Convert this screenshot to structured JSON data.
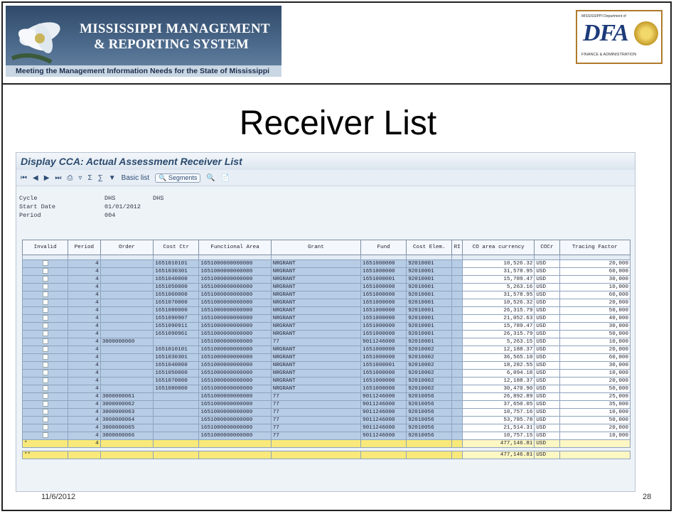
{
  "banner": {
    "line1": "MISSISSIPPI MANAGEMENT",
    "line2": "& REPORTING SYSTEM",
    "tagline": "Meeting the Management Information Needs for the State of Mississippi"
  },
  "logo": {
    "top_text": "MISSISSIPPI Department of",
    "mark": "DFA",
    "bottom_text": "FINANCE & ADMINISTRATION"
  },
  "slide_title": "Receiver List",
  "sap": {
    "window_title": "Display CCA: Actual Assessment Receiver List",
    "toolbar": {
      "basic_list": "Basic list",
      "segments": "Segments"
    },
    "meta": [
      {
        "label": "Cycle",
        "value": "DHS",
        "extra": "DHS"
      },
      {
        "label": "Start Date",
        "value": "01/01/2012",
        "extra": ""
      },
      {
        "label": "Period",
        "value": "004",
        "extra": ""
      }
    ],
    "columns": [
      "Invalid",
      "Period",
      "Order",
      "Cost Ctr",
      "Functional Area",
      "Grant",
      "Fund",
      "Cost Elem.",
      "RI",
      "CO area currency",
      "COCr",
      "Tracing Factor"
    ],
    "rows": [
      {
        "period": "4",
        "order": "",
        "cost_ctr": "1651010101",
        "func_area": "1651000000000000",
        "grant": "NRGRANT",
        "fund": "1651000000",
        "cost_elem": "92010001",
        "amount": "10,526.32",
        "cur": "USD",
        "factor": "20,000"
      },
      {
        "period": "4",
        "order": "",
        "cost_ctr": "1651030301",
        "func_area": "1651000000000000",
        "grant": "NRGRANT",
        "fund": "1651000000",
        "cost_elem": "92010001",
        "amount": "31,578.95",
        "cur": "USD",
        "factor": "60,000"
      },
      {
        "period": "4",
        "order": "",
        "cost_ctr": "1651040000",
        "func_area": "1651000000000000",
        "grant": "NRGRANT",
        "fund": "1651000001",
        "cost_elem": "92010001",
        "amount": "15,789.47",
        "cur": "USD",
        "factor": "30,000"
      },
      {
        "period": "4",
        "order": "",
        "cost_ctr": "1651050000",
        "func_area": "1651000000000000",
        "grant": "NRGRANT",
        "fund": "1651000000",
        "cost_elem": "92010001",
        "amount": "5,263.16",
        "cur": "USD",
        "factor": "10,000"
      },
      {
        "period": "4",
        "order": "",
        "cost_ctr": "1651060000",
        "func_area": "1651000000000000",
        "grant": "NRGRANT",
        "fund": "1651000000",
        "cost_elem": "92010001",
        "amount": "31,578.95",
        "cur": "USD",
        "factor": "60,000"
      },
      {
        "period": "4",
        "order": "",
        "cost_ctr": "1651070000",
        "func_area": "1651000000000000",
        "grant": "NRGRANT",
        "fund": "1651000000",
        "cost_elem": "92010001",
        "amount": "10,526.32",
        "cur": "USD",
        "factor": "20,000"
      },
      {
        "period": "4",
        "order": "",
        "cost_ctr": "1651080000",
        "func_area": "1651000000000000",
        "grant": "NRGRANT",
        "fund": "1651000000",
        "cost_elem": "92010001",
        "amount": "26,315.79",
        "cur": "USD",
        "factor": "50,000"
      },
      {
        "period": "4",
        "order": "",
        "cost_ctr": "1651090907",
        "func_area": "1651000000000000",
        "grant": "NRGRANT",
        "fund": "1651000000",
        "cost_elem": "92010001",
        "amount": "21,052.63",
        "cur": "USD",
        "factor": "40,000"
      },
      {
        "period": "4",
        "order": "",
        "cost_ctr": "1651090911",
        "func_area": "1651000000000000",
        "grant": "NRGRANT",
        "fund": "1651000000",
        "cost_elem": "92010001",
        "amount": "15,789.47",
        "cur": "USD",
        "factor": "30,000"
      },
      {
        "period": "4",
        "order": "",
        "cost_ctr": "1651090961",
        "func_area": "1651000000000000",
        "grant": "NRGRANT",
        "fund": "1651000000",
        "cost_elem": "92010001",
        "amount": "26,315.79",
        "cur": "USD",
        "factor": "50,000"
      },
      {
        "period": "4",
        "order": "3000000060",
        "cost_ctr": "",
        "func_area": "1651000000000000",
        "grant": "77",
        "fund": "9011246000",
        "cost_elem": "92010001",
        "amount": "5,263.15",
        "cur": "USD",
        "factor": "10,000"
      },
      {
        "period": "4",
        "order": "",
        "cost_ctr": "1651010101",
        "func_area": "1651000000000000",
        "grant": "NRGRANT",
        "fund": "1651000000",
        "cost_elem": "92010002",
        "amount": "12,188.37",
        "cur": "USD",
        "factor": "20,000"
      },
      {
        "period": "4",
        "order": "",
        "cost_ctr": "1651030301",
        "func_area": "1651000000000000",
        "grant": "NRGRANT",
        "fund": "1651000000",
        "cost_elem": "92010002",
        "amount": "36,565.10",
        "cur": "USD",
        "factor": "60,000"
      },
      {
        "period": "4",
        "order": "",
        "cost_ctr": "1651040000",
        "func_area": "1651000000000000",
        "grant": "NRGRANT",
        "fund": "1651000001",
        "cost_elem": "92010002",
        "amount": "18,282.55",
        "cur": "USD",
        "factor": "30,000"
      },
      {
        "period": "4",
        "order": "",
        "cost_ctr": "1651050000",
        "func_area": "1651000000000000",
        "grant": "NRGRANT",
        "fund": "1651000000",
        "cost_elem": "92010002",
        "amount": "6,094.18",
        "cur": "USD",
        "factor": "10,000"
      },
      {
        "period": "4",
        "order": "",
        "cost_ctr": "1651070000",
        "func_area": "1651000000000000",
        "grant": "NRGRANT",
        "fund": "1651000000",
        "cost_elem": "92010002",
        "amount": "12,188.37",
        "cur": "USD",
        "factor": "20,000"
      },
      {
        "period": "4",
        "order": "",
        "cost_ctr": "1651080000",
        "func_area": "1651000000000000",
        "grant": "NRGRANT",
        "fund": "1651000000",
        "cost_elem": "92010002",
        "amount": "30,470.90",
        "cur": "USD",
        "factor": "50,000"
      },
      {
        "period": "4",
        "order": "3000000061",
        "cost_ctr": "",
        "func_area": "1651000000000000",
        "grant": "77",
        "fund": "9011246000",
        "cost_elem": "92010056",
        "amount": "26,892.89",
        "cur": "USD",
        "factor": "25,000"
      },
      {
        "period": "4",
        "order": "3000000062",
        "cost_ctr": "",
        "func_area": "1651000000000000",
        "grant": "77",
        "fund": "9011246000",
        "cost_elem": "92010056",
        "amount": "37,650.05",
        "cur": "USD",
        "factor": "35,000"
      },
      {
        "period": "4",
        "order": "3000000063",
        "cost_ctr": "",
        "func_area": "1651000000000000",
        "grant": "77",
        "fund": "9011246000",
        "cost_elem": "92010056",
        "amount": "10,757.16",
        "cur": "USD",
        "factor": "10,000"
      },
      {
        "period": "4",
        "order": "3000000064",
        "cost_ctr": "",
        "func_area": "1651000000000000",
        "grant": "77",
        "fund": "9011246000",
        "cost_elem": "92010056",
        "amount": "53,785.78",
        "cur": "USD",
        "factor": "50,000"
      },
      {
        "period": "4",
        "order": "3000000065",
        "cost_ctr": "",
        "func_area": "1651000000000000",
        "grant": "77",
        "fund": "9011246000",
        "cost_elem": "92010056",
        "amount": "21,514.31",
        "cur": "USD",
        "factor": "20,000"
      },
      {
        "period": "4",
        "order": "3000000066",
        "cost_ctr": "",
        "func_area": "1651000000000000",
        "grant": "77",
        "fund": "9011246000",
        "cost_elem": "92010056",
        "amount": "10,757.15",
        "cur": "USD",
        "factor": "10,000"
      }
    ],
    "subtotal": {
      "marker": "*",
      "period": "4",
      "amount": "477,146.81",
      "cur": "USD"
    },
    "total": {
      "marker": "**",
      "amount": "477,146.81",
      "cur": "USD"
    }
  },
  "footer": {
    "date": "11/6/2012",
    "page": "28"
  }
}
